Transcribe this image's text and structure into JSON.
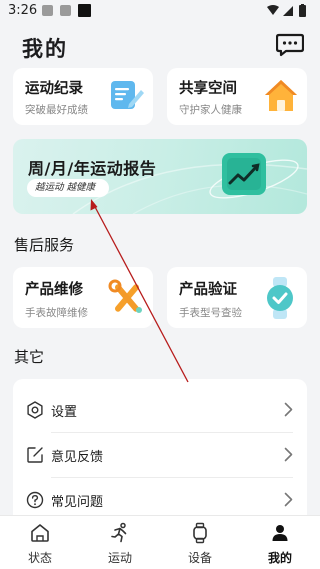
{
  "status_bar": {
    "time": "3:26"
  },
  "header": {
    "title": "我的"
  },
  "top_cards": [
    {
      "title": "运动纪录",
      "subtitle": "突破最好成绩"
    },
    {
      "title": "共享空间",
      "subtitle": "守护家人健康"
    }
  ],
  "banner": {
    "title": "周/月/年运动报告",
    "tagline": "越运动 越健康"
  },
  "after_sales": {
    "section_title": "售后服务",
    "cards": [
      {
        "title": "产品维修",
        "subtitle": "手表故障维修"
      },
      {
        "title": "产品验证",
        "subtitle": "手表型号查验"
      }
    ]
  },
  "others": {
    "section_title": "其它",
    "items": [
      {
        "label": "设置",
        "icon": "settings-icon"
      },
      {
        "label": "意见反馈",
        "icon": "feedback-icon"
      },
      {
        "label": "常见问题",
        "icon": "faq-icon"
      }
    ]
  },
  "tabbar": {
    "active_index": 3,
    "items": [
      {
        "label": "状态",
        "icon": "home-icon"
      },
      {
        "label": "运动",
        "icon": "running-icon"
      },
      {
        "label": "设备",
        "icon": "watch-icon"
      },
      {
        "label": "我的",
        "icon": "profile-icon"
      }
    ]
  },
  "colors": {
    "accent_teal": "#2fbf9f",
    "banner_bg": "#c9eee6",
    "annotation_arrow": "#b71c1c"
  }
}
